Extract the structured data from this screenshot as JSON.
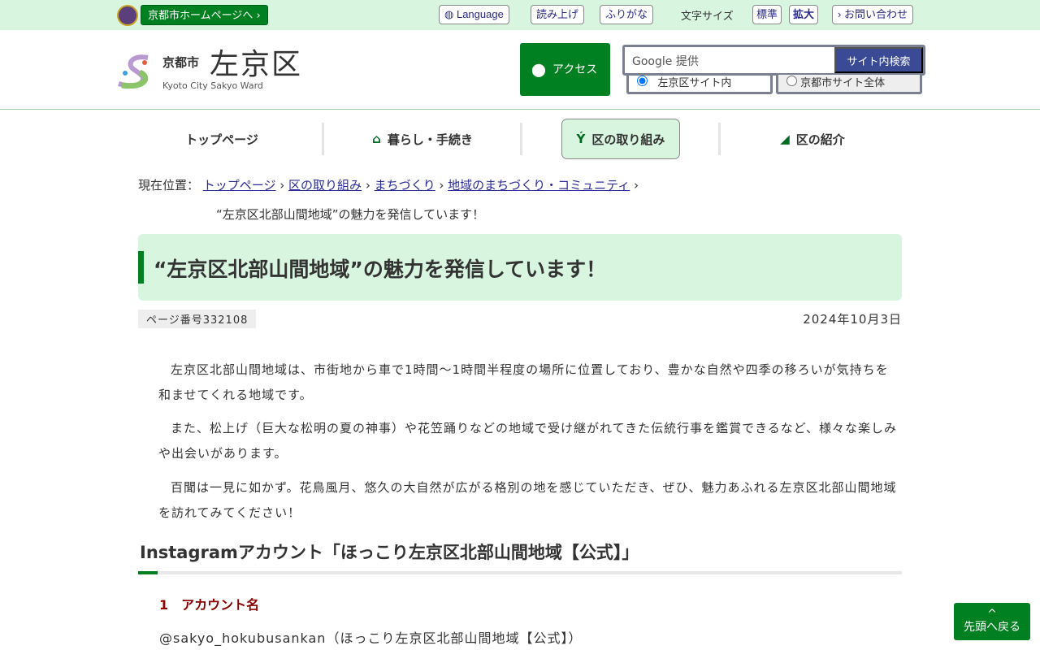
{
  "topbar": {
    "home_link": "京都市ホームページへ ›",
    "language": "Language",
    "read_aloud": "読み上げ",
    "furigana": "ふりがな",
    "font_size_label": "文字サイズ",
    "font_standard": "標準",
    "font_large": "拡大",
    "contact": "› お問い合わせ"
  },
  "header": {
    "logo_city": "京都市",
    "logo_ward": "左京区",
    "logo_en": "Kyoto City Sakyo Ward",
    "access": "アクセス",
    "search_provider": "Google 提供",
    "search_button": "サイト内検索",
    "radio_ward": "左京区サイト内",
    "radio_city": "京都市サイト全体"
  },
  "nav": [
    "トップページ",
    "暮らし・手続き",
    "区の取り組み",
    "区の紹介"
  ],
  "breadcrumb": {
    "label": "現在位置：",
    "items": [
      "トップページ",
      "区の取り組み",
      "まちづくり",
      "地域のまちづくり・コミュニティ"
    ],
    "current": "“左京区北部山間地域”の魅力を発信しています！"
  },
  "page": {
    "title": "“左京区北部山間地域”の魅力を発信しています！",
    "page_number": "ページ番号332108",
    "date": "2024年10月3日",
    "paragraphs": [
      "左京区北部山間地域は、市街地から車で1時間～1時間半程度の場所に位置しており、豊かな自然や四季の移ろいが気持ちを和ませてくれる地域です。",
      "また、松上げ（巨大な松明の夏の神事）や花笠踊りなどの地域で受け継がれてきた伝統行事を鑑賞できるなど、様々な楽しみや出会いがあります。",
      "百聞は一見に如かず。花鳥風月、悠久の大自然が広がる格別の地を感じていただき、ぜひ、魅力あふれる左京区北部山間地域を訪れてみてください！"
    ],
    "h2": "Instagramアカウント「ほっこり左京区北部山間地域【公式】」",
    "h3": "1　アカウント名",
    "account": "@sakyo_hokubusankan（ほっこり左京区北部山間地域【公式】）"
  },
  "back_to_top": "先頭へ戻る"
}
